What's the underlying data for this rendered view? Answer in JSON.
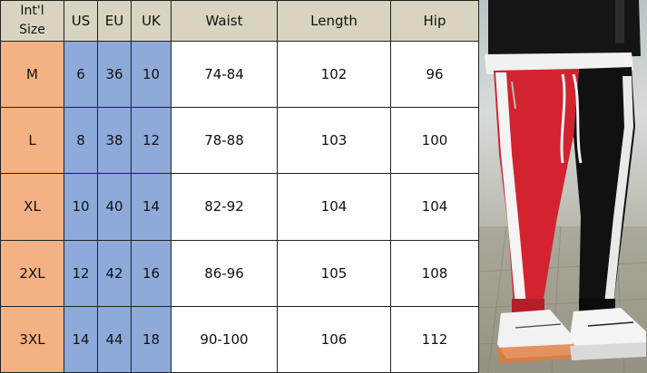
{
  "table": {
    "headers": {
      "size_line1": "Int'l",
      "size_line2": "Size",
      "us": "US",
      "eu": "EU",
      "uk": "UK",
      "waist": "Waist",
      "length": "Length",
      "hip": "Hip"
    },
    "rows": [
      {
        "size": "M",
        "us": "6",
        "eu": "36",
        "uk": "10",
        "waist": "74-84",
        "length": "102",
        "hip": "96"
      },
      {
        "size": "L",
        "us": "8",
        "eu": "38",
        "uk": "12",
        "waist": "78-88",
        "length": "103",
        "hip": "100"
      },
      {
        "size": "XL",
        "us": "10",
        "eu": "40",
        "uk": "14",
        "waist": "82-92",
        "length": "104",
        "hip": "104"
      },
      {
        "size": "2XL",
        "us": "12",
        "eu": "42",
        "uk": "16",
        "waist": "86-96",
        "length": "105",
        "hip": "108"
      },
      {
        "size": "3XL",
        "us": "14",
        "eu": "44",
        "uk": "18",
        "waist": "90-100",
        "length": "106",
        "hip": "112"
      }
    ]
  },
  "colors": {
    "header_bg": "#d9d4bf",
    "size_col": "#f4b183",
    "region_cols": "#8eaadb",
    "pants_red": "#d2232f",
    "pants_black": "#111111",
    "stripe_white": "#f4f4f4"
  },
  "photo": {
    "subject": "red-black-track-pants-photo"
  }
}
